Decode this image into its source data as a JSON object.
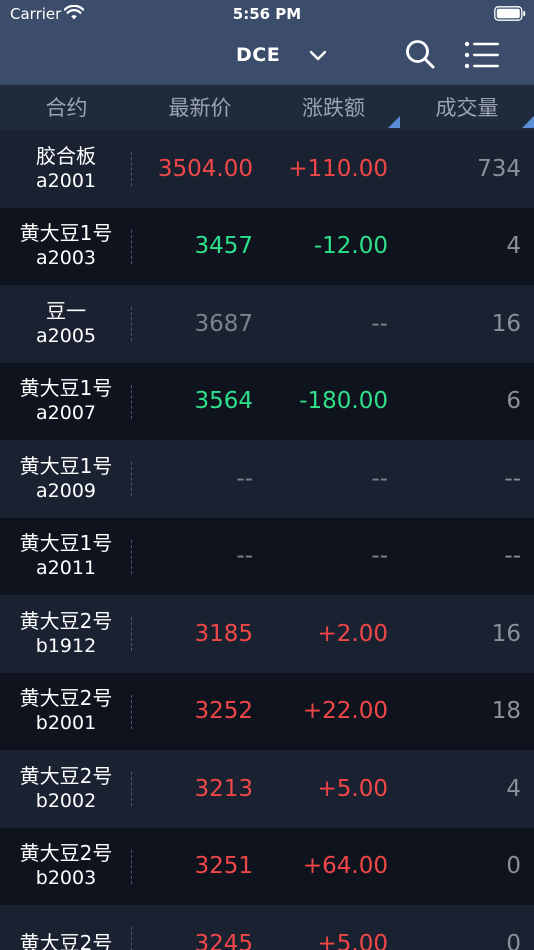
{
  "status_bar": {
    "carrier": "Carrier",
    "time": "5:56 PM"
  },
  "nav": {
    "exchange": "DCE"
  },
  "columns": {
    "name": "合约",
    "price": "最新价",
    "change": "涨跌额",
    "volume": "成交量"
  },
  "colors": {
    "up": "#f04848",
    "down": "#2fe08a",
    "flat": "#7d828c",
    "header": "#3b4d6a"
  },
  "rows": [
    {
      "name": "胶合板",
      "code": "a2001",
      "price": "3504.00",
      "change": "+110.00",
      "volume": "734",
      "trend": "up"
    },
    {
      "name": "黄大豆1号",
      "code": "a2003",
      "price": "3457",
      "change": "-12.00",
      "volume": "4",
      "trend": "down"
    },
    {
      "name": "豆一",
      "code": "a2005",
      "price": "3687",
      "change": "--",
      "volume": "16",
      "trend": "flat"
    },
    {
      "name": "黄大豆1号",
      "code": "a2007",
      "price": "3564",
      "change": "-180.00",
      "volume": "6",
      "trend": "down"
    },
    {
      "name": "黄大豆1号",
      "code": "a2009",
      "price": "--",
      "change": "--",
      "volume": "--",
      "trend": "flat"
    },
    {
      "name": "黄大豆1号",
      "code": "a2011",
      "price": "--",
      "change": "--",
      "volume": "--",
      "trend": "flat"
    },
    {
      "name": "黄大豆2号",
      "code": "b1912",
      "price": "3185",
      "change": "+2.00",
      "volume": "16",
      "trend": "up"
    },
    {
      "name": "黄大豆2号",
      "code": "b2001",
      "price": "3252",
      "change": "+22.00",
      "volume": "18",
      "trend": "up"
    },
    {
      "name": "黄大豆2号",
      "code": "b2002",
      "price": "3213",
      "change": "+5.00",
      "volume": "4",
      "trend": "up"
    },
    {
      "name": "黄大豆2号",
      "code": "b2003",
      "price": "3251",
      "change": "+64.00",
      "volume": "0",
      "trend": "up"
    },
    {
      "name": "黄大豆2号",
      "code": "",
      "price": "3245",
      "change": "+5.00",
      "volume": "0",
      "trend": "up"
    }
  ]
}
